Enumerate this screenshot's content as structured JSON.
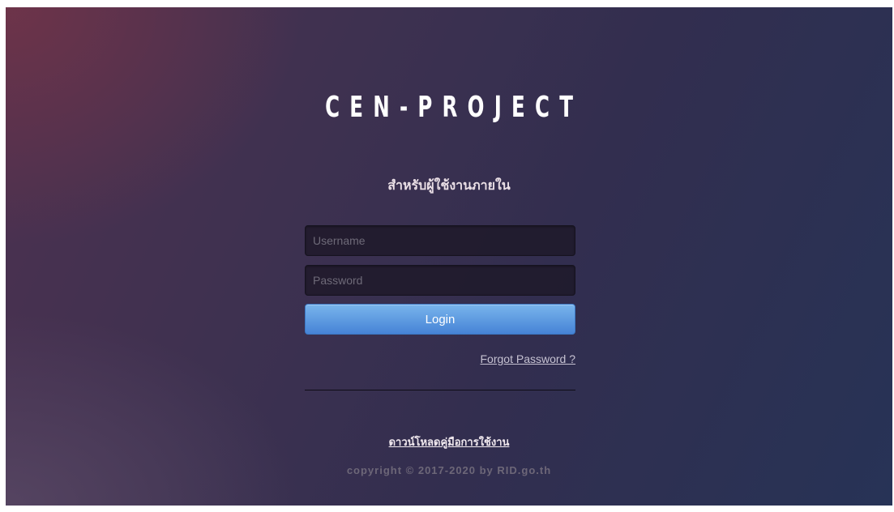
{
  "brand": {
    "logo_text": "CEN-PROJECT"
  },
  "header": {
    "subtitle": "สำหรับผู้ใช้งานภายใน"
  },
  "login_form": {
    "username_placeholder": "Username",
    "password_placeholder": "Password",
    "login_label": "Login",
    "forgot_password_label": "Forgot Password ?"
  },
  "footer": {
    "manual_link": "ดาวน์โหลดคู่มือการใช้งาน",
    "copyright": "copyright © 2017-2020 by RID.go.th"
  },
  "colors": {
    "login_button": "#5d9be2",
    "background_left": "#4d3150",
    "background_right": "#273356"
  }
}
